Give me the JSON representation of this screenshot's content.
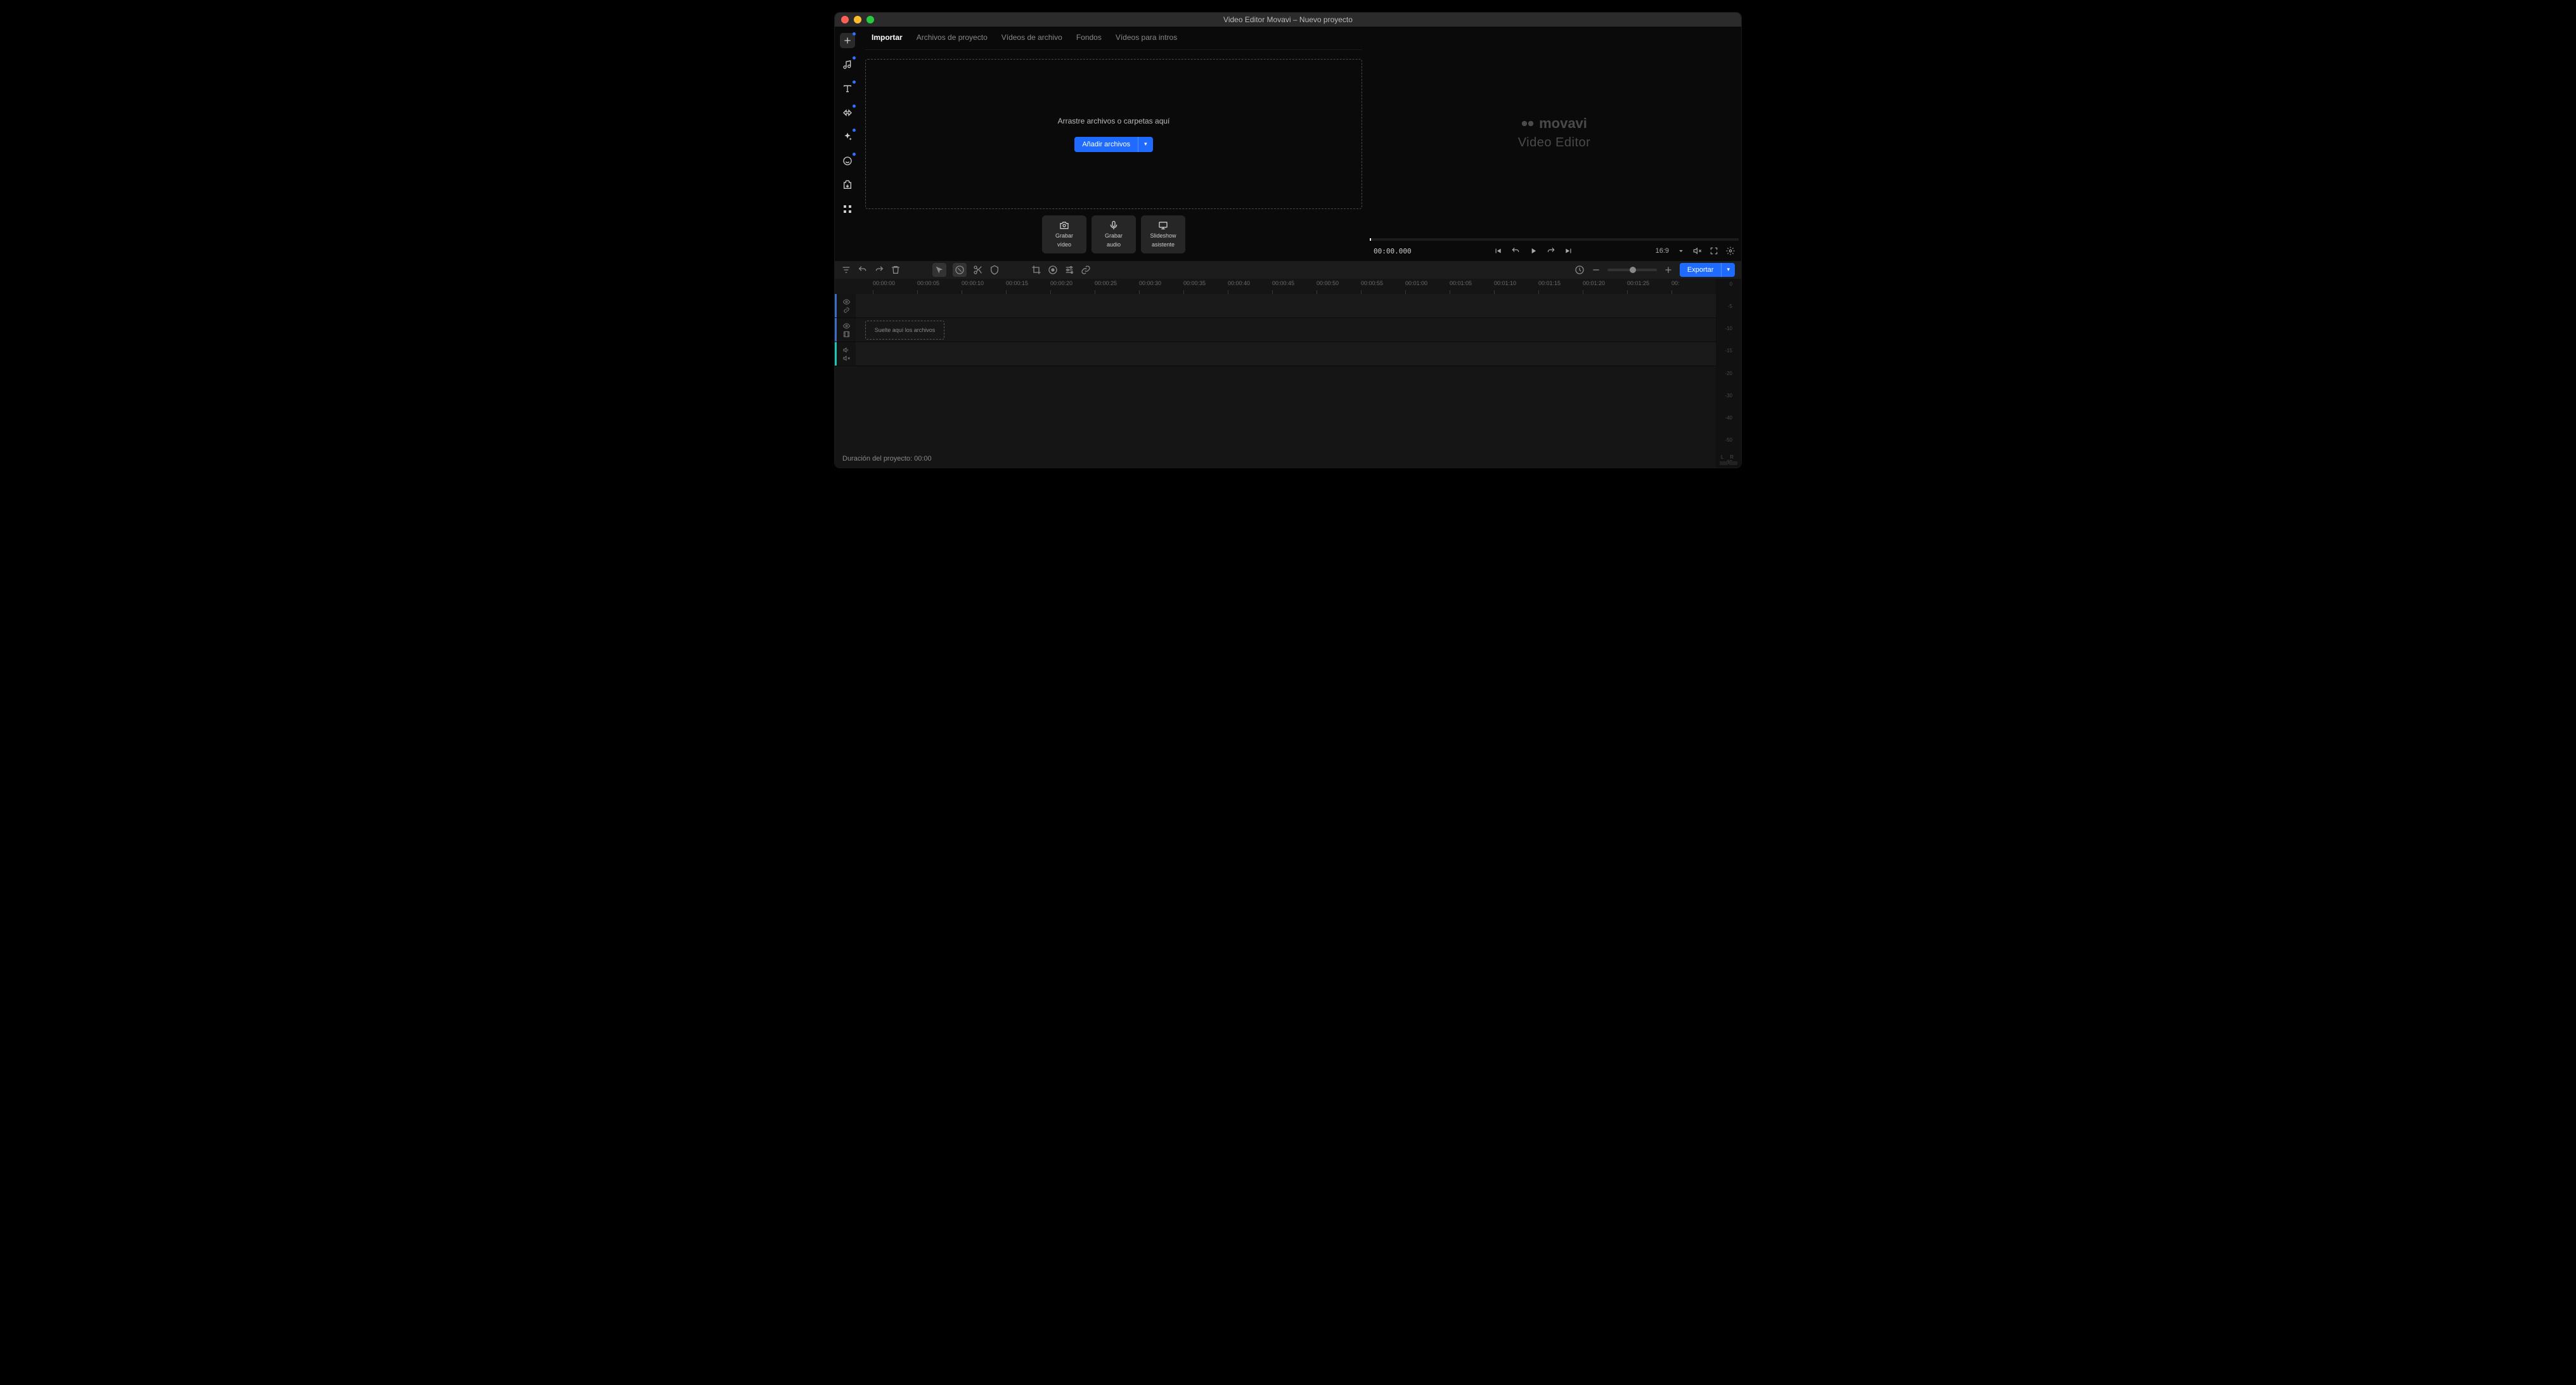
{
  "titlebar": {
    "title": "Video Editor Movavi – Nuevo proyecto"
  },
  "tabs": [
    "Importar",
    "Archivos de proyecto",
    "Vídeos de archivo",
    "Fondos",
    "Vídeos para intros"
  ],
  "active_tab": 0,
  "drop": {
    "text": "Arrastre archivos o carpetas aquí",
    "button": "Añadir archivos"
  },
  "record_cards": [
    {
      "label1": "Grabar",
      "label2": "vídeo"
    },
    {
      "label1": "Grabar",
      "label2": "audio"
    },
    {
      "label1": "Slideshow",
      "label2": "asistente"
    }
  ],
  "preview": {
    "logo_text": "movavi",
    "sub_text": "Video Editor",
    "timecode": "00:00.000",
    "aspect": "16:9"
  },
  "export_label": "Exportar",
  "ruler": [
    "00:00:00",
    "00:00:05",
    "00:00:10",
    "00:00:15",
    "00:00:20",
    "00:00:25",
    "00:00:30",
    "00:00:35",
    "00:00:40",
    "00:00:45",
    "00:00:50",
    "00:00:55",
    "00:01:00",
    "00:01:05",
    "00:01:10",
    "00:01:15",
    "00:01:20",
    "00:01:25",
    "00:"
  ],
  "drop_hint": "Suelte aquí los archivos",
  "meter_ticks": [
    "0",
    "-5",
    "-10",
    "-15",
    "-20",
    "-30",
    "-40",
    "-50",
    "-60"
  ],
  "meter_lr": "L   R",
  "duration": "Duración del proyecto: 00:00"
}
